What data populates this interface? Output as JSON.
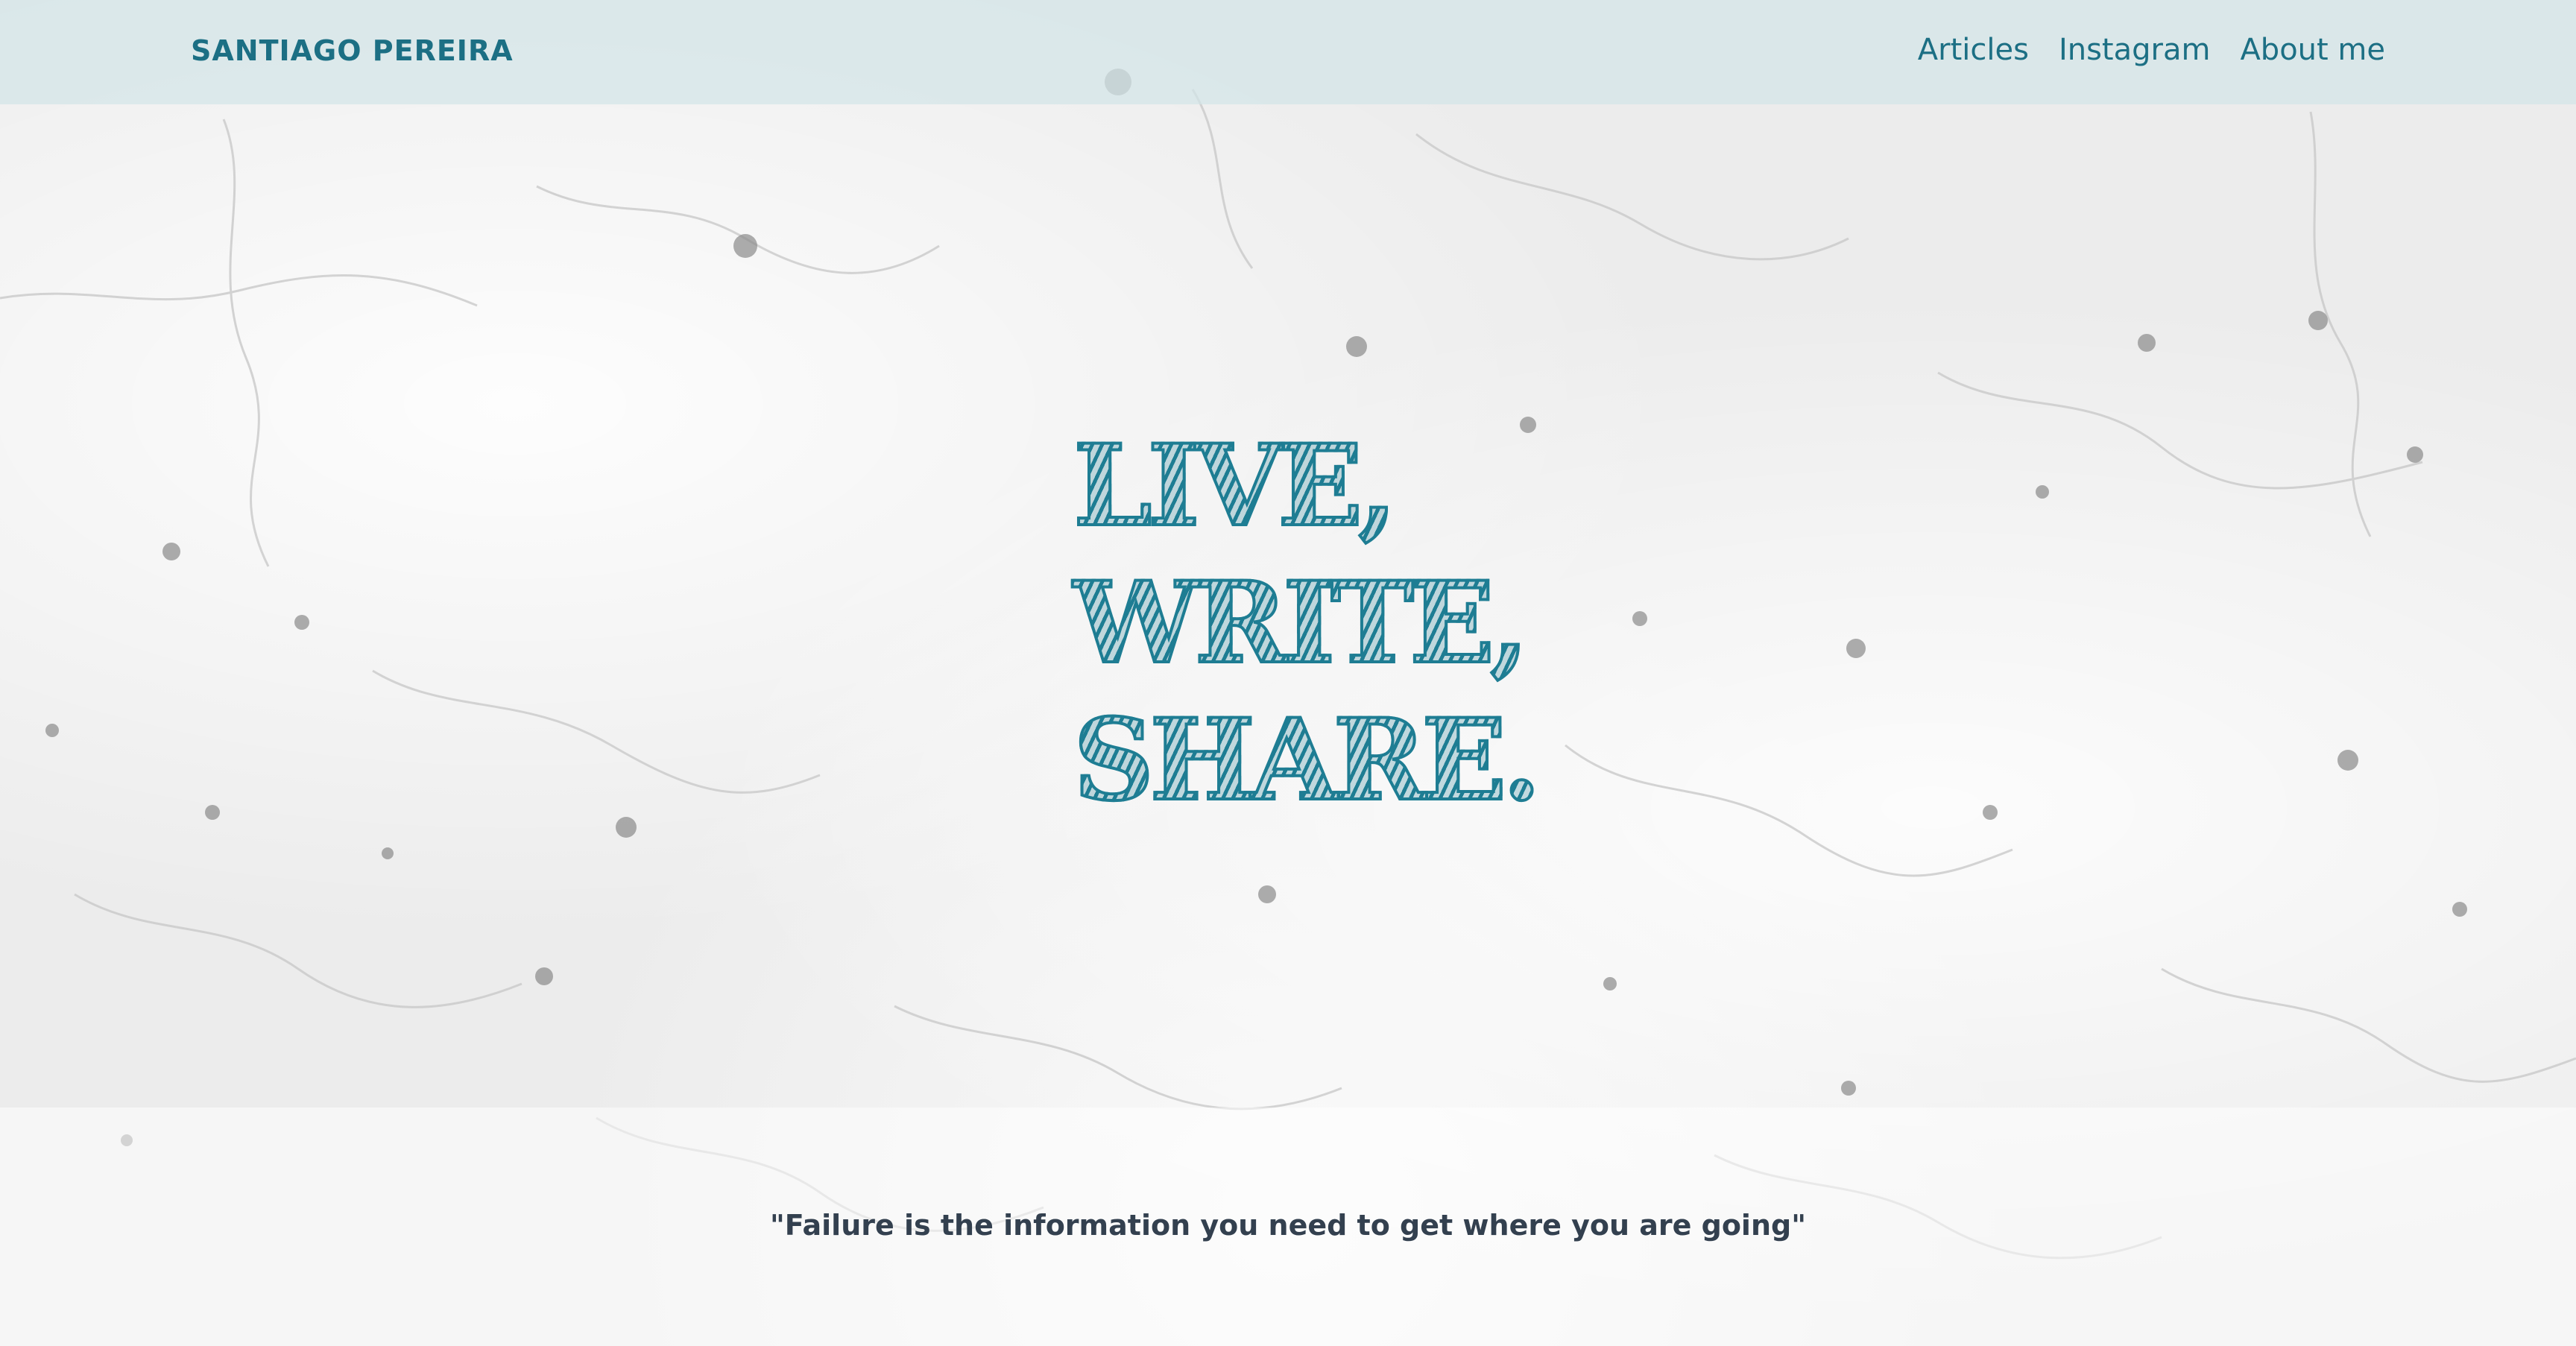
{
  "header": {
    "brand": "SANTIAGO PEREIRA",
    "nav": [
      {
        "label": "Articles"
      },
      {
        "label": "Instagram"
      },
      {
        "label": "About me"
      }
    ]
  },
  "hero": {
    "lines": [
      "LIVE,",
      "WRITE,",
      "SHARE."
    ]
  },
  "quote": {
    "text": "\"Failure is the information you need to get where you are going\""
  },
  "colors": {
    "accent": "#1c6f84",
    "hero_text": "#1e7d93",
    "quote_text": "#33404f",
    "navbar_bg": "#d2e4e8"
  }
}
